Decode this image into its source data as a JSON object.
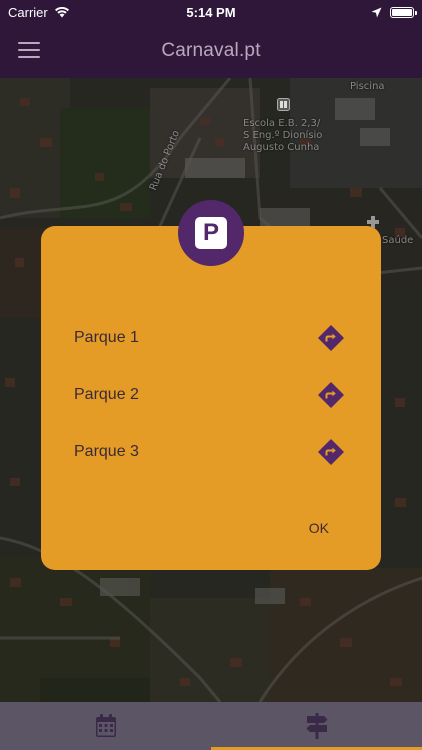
{
  "status_bar": {
    "carrier": "Carrier",
    "time": "5:14 PM"
  },
  "app_bar": {
    "title": "Carnaval.pt",
    "menu_icon": "hamburger-menu-icon"
  },
  "map": {
    "labels": {
      "piscina": "Piscina",
      "school": "Escola E.B. 2,3/\nS Eng.º Dionísio\nAugusto Cunha",
      "street": "Rua do Porto",
      "saude": "Saúde"
    }
  },
  "dialog": {
    "badge_letter": "P",
    "badge_icon": "parking-icon",
    "parks": [
      {
        "name": "Parque 1",
        "icon": "directions-icon"
      },
      {
        "name": "Parque 2",
        "icon": "directions-icon"
      },
      {
        "name": "Parque 3",
        "icon": "directions-icon"
      }
    ],
    "ok_label": "OK"
  },
  "bottom_nav": {
    "tabs": [
      {
        "icon": "calendar-icon",
        "active": false
      },
      {
        "icon": "signpost-icon",
        "active": true
      }
    ]
  },
  "colors": {
    "app_bar": "#2e1738",
    "dialog": "#e49c26",
    "badge": "#52286a",
    "nav_bar": "#5c5566",
    "active_indicator": "#e49b22"
  }
}
